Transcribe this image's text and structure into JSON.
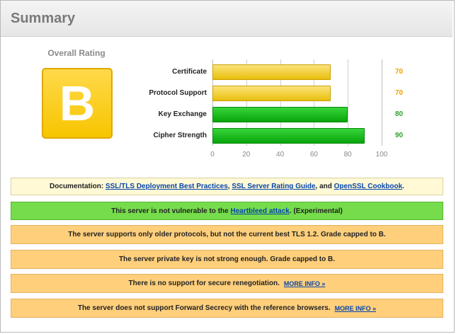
{
  "header": {
    "title": "Summary"
  },
  "overall": {
    "label": "Overall Rating",
    "grade": "B",
    "grade_color": "#f7c500"
  },
  "chart_data": {
    "type": "bar",
    "orientation": "horizontal",
    "categories": [
      "Certificate",
      "Protocol Support",
      "Key Exchange",
      "Cipher Strength"
    ],
    "values": [
      70,
      70,
      80,
      90
    ],
    "colors": [
      "#e9bf0c",
      "#e9bf0c",
      "#07a40b",
      "#07a40b"
    ],
    "xlim": [
      0,
      100
    ],
    "xticks": [
      "0",
      "20",
      "40",
      "60",
      "80",
      "100"
    ],
    "score_labels": [
      "70",
      "70",
      "80",
      "90"
    ],
    "score_colors": [
      "#f0a000",
      "#f0a000",
      "#2aa52a",
      "#2aa52a"
    ],
    "grid": true
  },
  "banners": {
    "doc": {
      "prefix": "Documentation: ",
      "link1": "SSL/TLS Deployment Best Practices",
      "sep1": ", ",
      "link2": "SSL Server Rating Guide",
      "sep2": ", and ",
      "link3": "OpenSSL Cookbook",
      "suffix": "."
    },
    "heartbleed": {
      "prefix": "This server is not vulnerable to the ",
      "link": "Heartbleed attack",
      "suffix": ". (Experimental)"
    },
    "protocols": {
      "text": "The server supports only older protocols, but not the current best TLS 1.2. Grade capped to B."
    },
    "privkey": {
      "text": "The server private key is not strong enough. Grade capped to B."
    },
    "renegotiation": {
      "text": "There is no support for secure renegotiation.",
      "more": "MORE INFO »"
    },
    "forward_secrecy": {
      "text": "The server does not support Forward Secrecy with the reference browsers.",
      "more": "MORE INFO »"
    }
  }
}
